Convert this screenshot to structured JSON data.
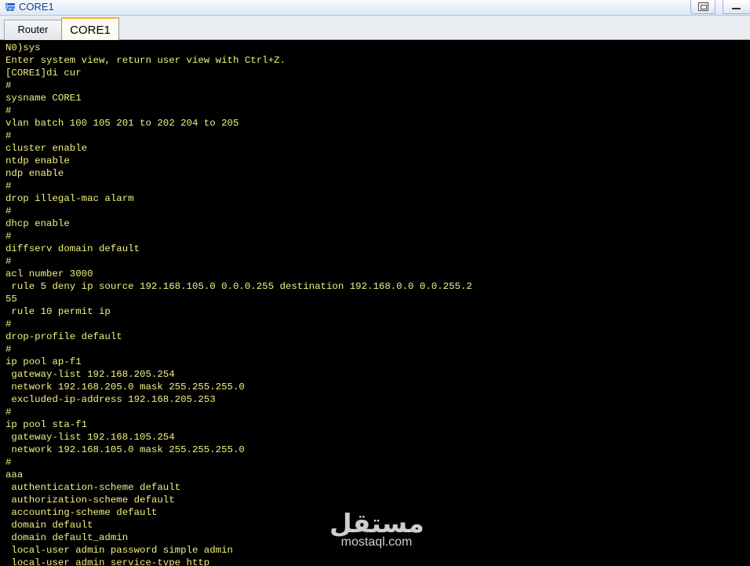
{
  "window": {
    "title": "CORE1",
    "icon": "network-device-icon",
    "accent_color": "#f2b33d"
  },
  "tabs": [
    {
      "label": "Router",
      "active": false
    },
    {
      "label": "CORE1",
      "active": true
    }
  ],
  "terminal": {
    "text_color": "#f2f082",
    "background_color": "#000000",
    "lines": [
      "N0)sys",
      "Enter system view, return user view with Ctrl+Z.",
      "[CORE1]di cur",
      "#",
      "sysname CORE1",
      "#",
      "vlan batch 100 105 201 to 202 204 to 205",
      "#",
      "cluster enable",
      "ntdp enable",
      "ndp enable",
      "#",
      "drop illegal-mac alarm",
      "#",
      "dhcp enable",
      "#",
      "diffserv domain default",
      "#",
      "acl number 3000",
      " rule 5 deny ip source 192.168.105.0 0.0.0.255 destination 192.168.0.0 0.0.255.2",
      "55",
      " rule 10 permit ip",
      "#",
      "drop-profile default",
      "#",
      "ip pool ap-f1",
      " gateway-list 192.168.205.254",
      " network 192.168.205.0 mask 255.255.255.0",
      " excluded-ip-address 192.168.205.253",
      "#",
      "ip pool sta-f1",
      " gateway-list 192.168.105.254",
      " network 192.168.105.0 mask 255.255.255.0",
      "#",
      "aaa",
      " authentication-scheme default",
      " authorization-scheme default",
      " accounting-scheme default",
      " domain default",
      " domain default_admin",
      " local-user admin password simple admin",
      " local-user admin service-type http"
    ]
  },
  "watermark": {
    "arabic_text": "مستقل",
    "latin_text": "mostaql.com"
  }
}
